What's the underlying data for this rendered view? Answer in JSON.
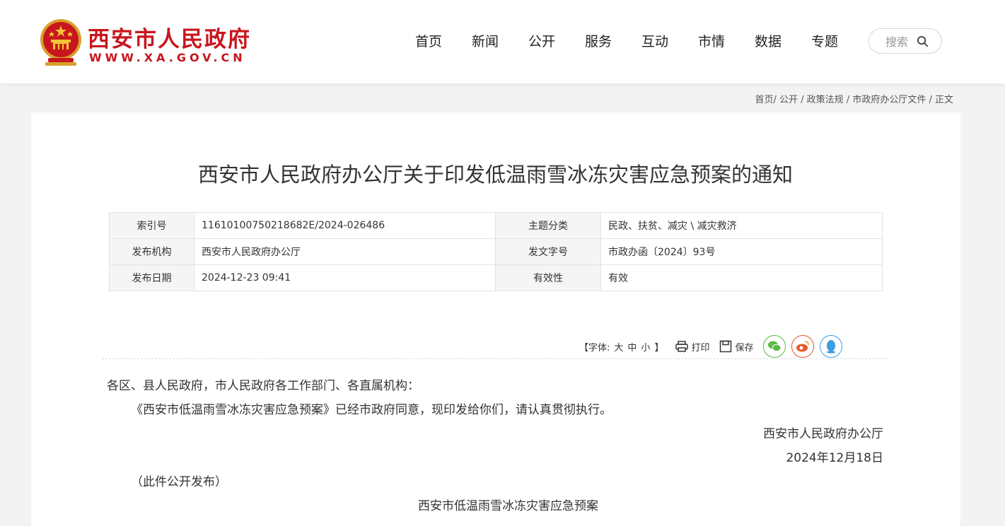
{
  "site": {
    "title": "西安市人民政府",
    "url": "WWW.XA.GOV.CN"
  },
  "nav": [
    "首页",
    "新闻",
    "公开",
    "服务",
    "互动",
    "市情",
    "数据",
    "专题"
  ],
  "search": {
    "label": "搜索"
  },
  "breadcrumb": [
    "首页",
    "公开",
    "政策法规",
    "市政府办公厅文件",
    "正文"
  ],
  "document": {
    "title": "西安市人民政府办公厅关于印发低温雨雪冰冻灾害应急预案的通知",
    "meta": [
      {
        "k1": "索引号",
        "v1": "11610100750218682E/2024-026486",
        "k2": "主题分类",
        "v2": "民政、扶贫、减灾 \\ 减灾救济"
      },
      {
        "k1": "发布机构",
        "v1": "西安市人民政府办公厅",
        "k2": "发文字号",
        "v2": "市政办函〔2024〕93号"
      },
      {
        "k1": "发布日期",
        "v1": "2024-12-23 09:41",
        "k2": "有效性",
        "v2": "有效"
      }
    ],
    "tools": {
      "font_prefix": "【字体:",
      "font_large": "大",
      "font_medium": "中",
      "font_small": "小",
      "font_suffix": "】",
      "print": "打印",
      "save": "保存"
    },
    "salutation": "各区、县人民政府，市人民政府各工作部门、各直属机构：",
    "paragraph": "《西安市低温雨雪冰冻灾害应急预案》已经市政府同意，现印发给你们，请认真贯彻执行。",
    "issuer": "西安市人民政府办公厅",
    "date": "2024年12月18日",
    "note": "（此件公开发布）",
    "attachment_title": "西安市低温雨雪冰冻灾害应急预案"
  },
  "colors": {
    "brand": "#c8161d",
    "wechat": "#5aba45",
    "weibo": "#e6572b",
    "qq": "#3a9ee0"
  }
}
